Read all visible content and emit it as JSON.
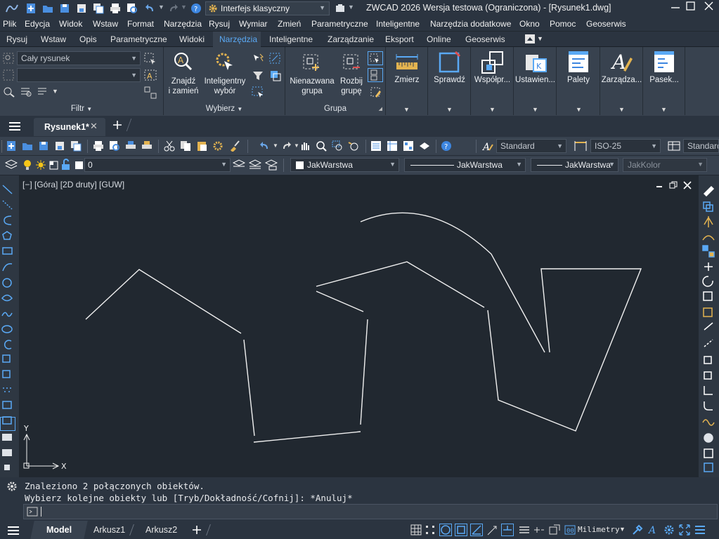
{
  "title": {
    "workspace": "Interfejs klasyczny",
    "window_title": "ZWCAD 2026 Wersja testowa (Ograniczona) - [Rysunek1.dwg]"
  },
  "menu": [
    "Plik",
    "Edycja",
    "Widok",
    "Wstaw",
    "Format",
    "Narzędzia",
    "Rysuj",
    "Wymiar",
    "Zmień",
    "Parametryczne",
    "Inteligentne",
    "Narzędzia dodatkowe",
    "Okno",
    "Pomoc",
    "Geoserwis"
  ],
  "ribbon_tabs": [
    "Rysuj",
    "Wstaw",
    "Opis",
    "Parametryczne",
    "Widoki",
    "Narzędzia",
    "Inteligentne",
    "Zarządzanie",
    "Eksport",
    "Online",
    "Geoserwis"
  ],
  "ribbon_active_tab": "Narzędzia",
  "ribbon": {
    "filter_combo": "Cały rysunek",
    "filter_panel": "Filtr",
    "find_replace": [
      "Znajdź",
      "i zamień"
    ],
    "smart_select": [
      "Inteligentny",
      "wybór"
    ],
    "select_panel": "Wybierz",
    "unnamed_group": [
      "Nienazwana",
      "grupa"
    ],
    "ungroup": [
      "Rozbij",
      "grupę"
    ],
    "group_panel": "Grupa",
    "measure": "Zmierz",
    "check": "Sprawdź",
    "collab": "Współpr...",
    "settings": "Ustawien...",
    "palettes": "Palety",
    "manage": "Zarządza...",
    "bar": "Pasek..."
  },
  "doc_tab": "Rysunek1*",
  "toolbar": {
    "text_style": "Standard",
    "dim_style": "ISO-25",
    "table_style": "Standard",
    "layer": "0",
    "color": "JakWarstwa",
    "linetype": "JakWarstwa",
    "lineweight": "JakWarstwa",
    "plotstyle": "JakKolor"
  },
  "viewport_label": "[−] [Góra] [2D druty] [GUW]",
  "ucs": {
    "x": "X",
    "y": "Y"
  },
  "command": {
    "line1": "Znaleziono 2 połączonych obiektów.",
    "line2": "Wybierz kolejne obiekty lub [Tryb/Dokładność/Cofnij]: *Anuluj*"
  },
  "status": {
    "tabs": [
      "Model",
      "Arkusz1",
      "Arkusz2"
    ],
    "units": "Milimetry"
  },
  "colors": {
    "accent": "#5aa9f5",
    "background": "#212830",
    "panel": "#38424f"
  }
}
